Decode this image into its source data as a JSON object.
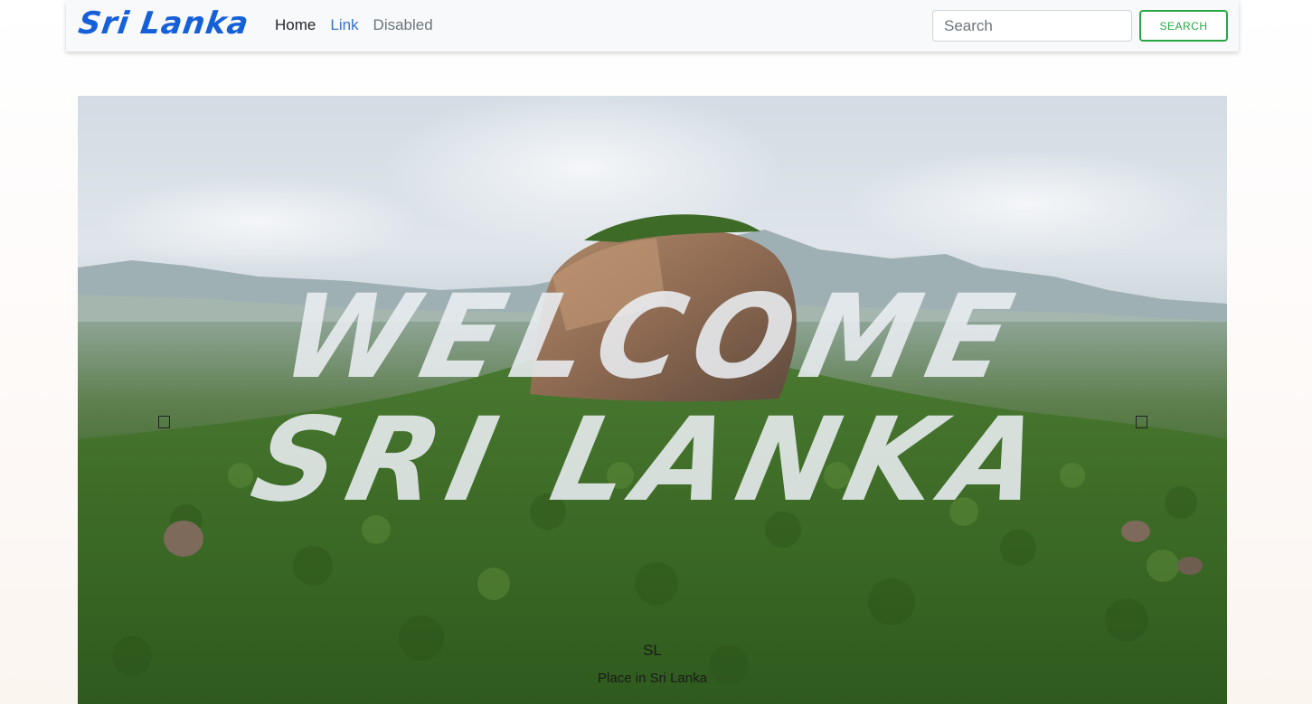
{
  "navbar": {
    "brand": "Sri Lanka",
    "links": [
      {
        "label": "Home"
      },
      {
        "label": "Link"
      },
      {
        "label": "Disabled"
      }
    ],
    "search": {
      "placeholder": "Search",
      "value": "",
      "button_label": "SEARCH"
    }
  },
  "carousel": {
    "headline_line1": "WELCOME",
    "headline_line2": "SRI LANKA",
    "caption_title": "SL",
    "caption_text": "Place in Sri Lanka",
    "prev_icon": "prev-square-icon",
    "next_icon": "next-square-icon"
  },
  "colors": {
    "brand": "#1560d9",
    "link": "#3b72c9",
    "search_button": "#28a745"
  }
}
